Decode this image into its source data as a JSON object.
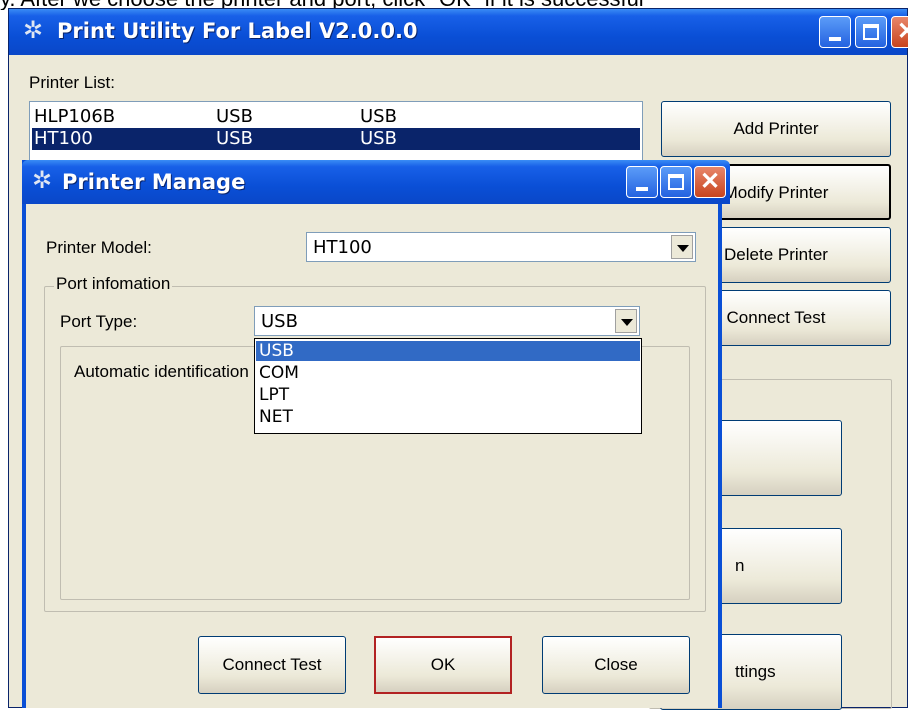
{
  "top_caption": "y. After we choose the printer and port, click \"OK\" if it is successful",
  "main_window": {
    "title": "Print Utility For Label V2.0.0.0",
    "printer_list_label": "Printer List:",
    "printers": [
      {
        "name": "HLP106B",
        "col2": "USB",
        "col3": "USB",
        "selected": false
      },
      {
        "name": "HT100",
        "col2": "USB",
        "col3": "USB",
        "selected": true
      }
    ],
    "buttons": {
      "add_printer": "Add Printer",
      "modify_printer": "Modify Printer",
      "delete_printer": "Delete Printer",
      "connect_test": "Connect Test",
      "partial_n": "n",
      "partial_settings": "ttings"
    }
  },
  "dialog": {
    "title": "Printer Manage",
    "printer_model_label": "Printer Model:",
    "printer_model_value": "HT100",
    "port_group_label": "Port infomation",
    "port_type_label": "Port Type:",
    "port_type_value": "USB",
    "auto_ident_label": "Automatic identification",
    "port_options": [
      "USB",
      "COM",
      "LPT",
      "NET"
    ],
    "port_selected_index": 0,
    "buttons": {
      "connect_test": "Connect Test",
      "ok": "OK",
      "close": "Close"
    }
  },
  "colors": {
    "titlebar": "#0a4fd6",
    "selection": "#0a246a",
    "dropdown_selection": "#316ac5",
    "ok_highlight": "#b22222",
    "window_face": "#ece9d8"
  }
}
